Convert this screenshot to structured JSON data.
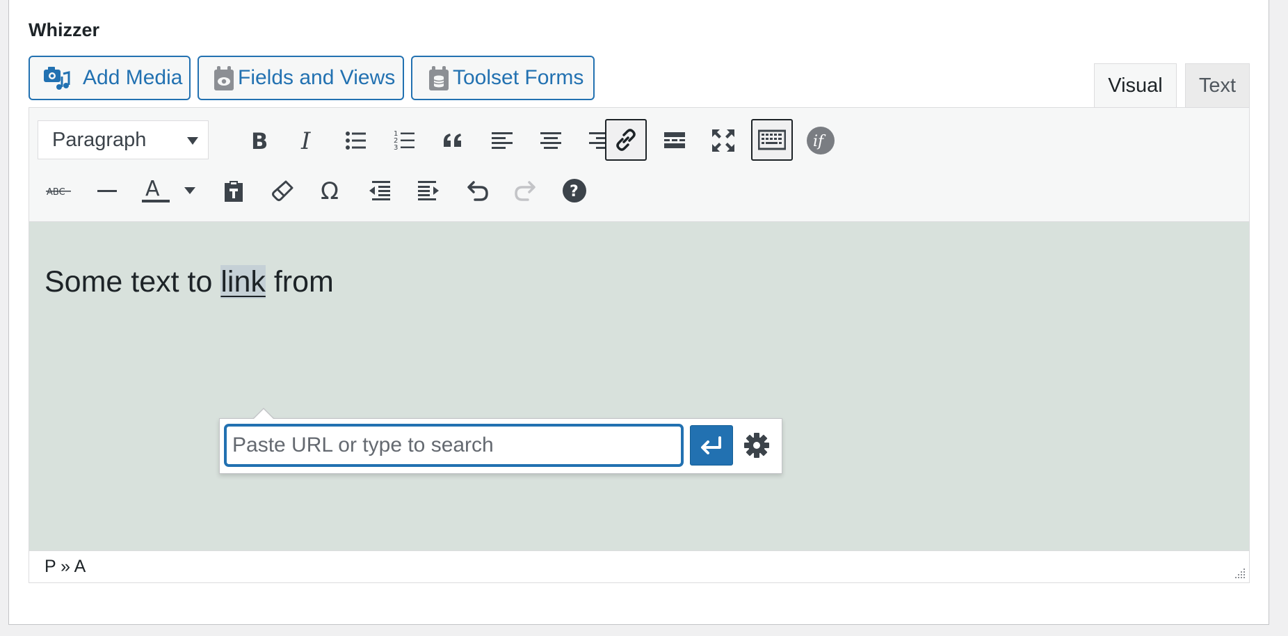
{
  "field": {
    "label": "Whizzer"
  },
  "media_buttons": [
    {
      "label": "Add Media",
      "icon": "add-media-icon"
    },
    {
      "label": "Fields and Views",
      "icon": "fields-views-icon"
    },
    {
      "label": "Toolset Forms",
      "icon": "toolset-forms-icon"
    }
  ],
  "tabs": {
    "visual": "Visual",
    "text": "Text",
    "active": "visual"
  },
  "toolbar": {
    "format_value": "Paragraph",
    "row1": [
      "bold",
      "italic",
      "bulleted-list",
      "numbered-list",
      "blockquote",
      "align-left",
      "align-center",
      "align-right",
      "insert-link",
      "read-more",
      "fullscreen",
      "toolbar-toggle",
      "conditional-output"
    ],
    "row2": [
      "strikethrough",
      "horizontal-line",
      "text-color",
      "paste-as-text",
      "clear-formatting",
      "special-character",
      "outdent",
      "indent",
      "undo",
      "redo",
      "keyboard-shortcuts"
    ],
    "pressed": [
      "insert-link",
      "toolbar-toggle"
    ]
  },
  "content": {
    "before": "Some text to ",
    "selected": "link",
    "after": " from"
  },
  "link_popup": {
    "placeholder": "Paste URL or type to search",
    "value": ""
  },
  "statusbar": {
    "path": "P » A"
  },
  "colors": {
    "accent": "#2271b1",
    "content_bg": "#d8e1dc",
    "toolbar_bg": "#f6f7f7"
  }
}
